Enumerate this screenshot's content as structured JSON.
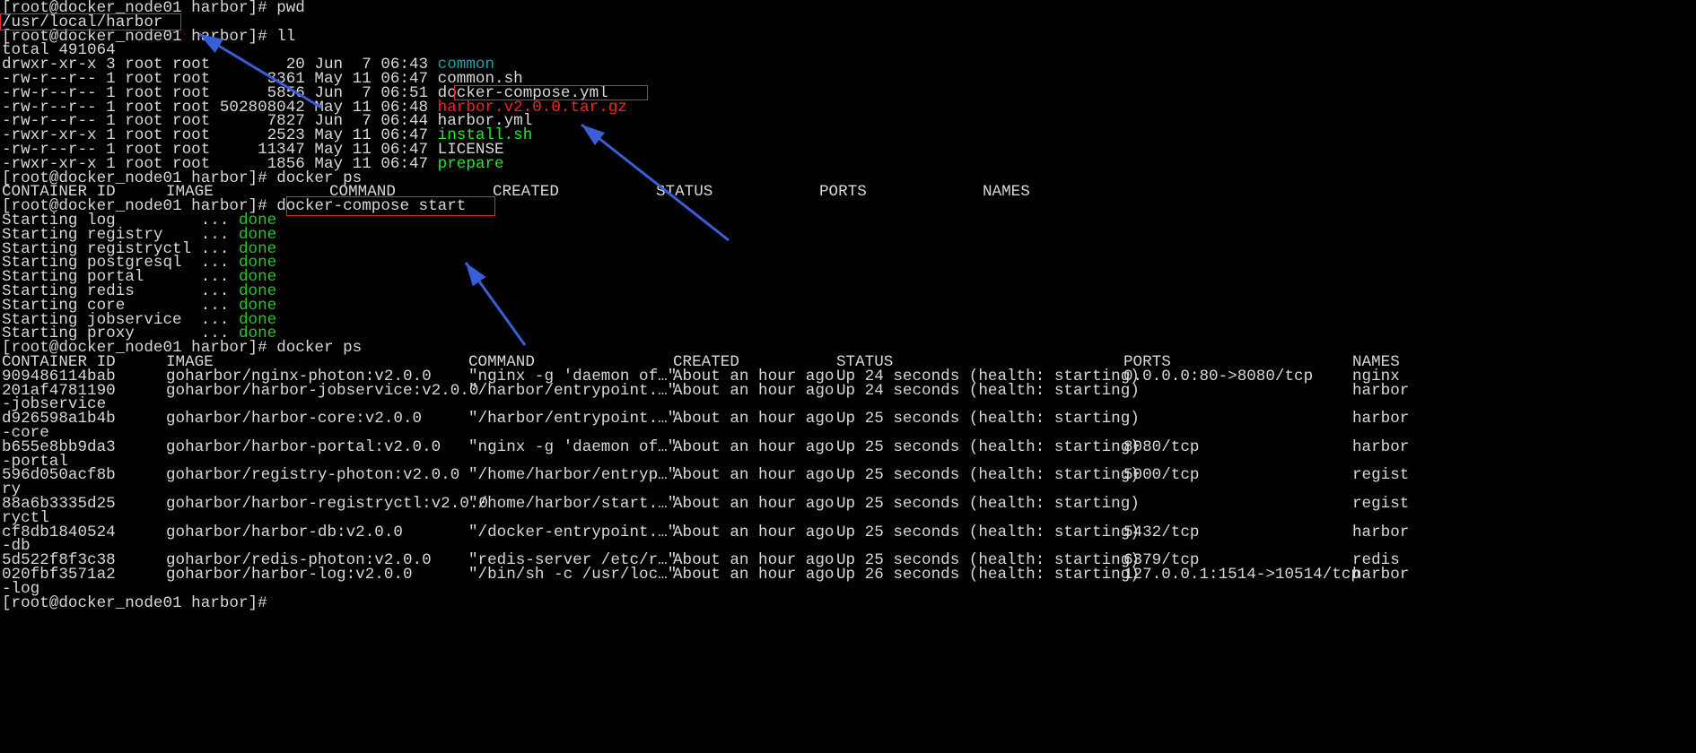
{
  "colors": {
    "background": "#000000",
    "text": "#d8d8d8",
    "dir": "#16a2a6",
    "exec": "#2ee02e",
    "archive": "#ff2020",
    "done": "#2ec22e",
    "highlight": "#e0272a",
    "arrow": "#3a5ed6"
  },
  "prompt": "[root@docker_node01 harbor]# ",
  "cmd_pwd": "pwd",
  "pwd_output": "/usr/local/harbor",
  "cmd_ll": "ll",
  "ll_total": "total 491064",
  "files": [
    {
      "meta": "drwxr-xr-x 3 root root        20 Jun  7 06:43 ",
      "name": "common",
      "kind": "dir"
    },
    {
      "meta": "-rw-r--r-- 1 root root      3361 May 11 06:47 ",
      "name": "common.sh",
      "kind": "file"
    },
    {
      "meta": "-rw-r--r-- 1 root root      5856 Jun  7 06:51 ",
      "name": "docker-compose.yml",
      "kind": "file"
    },
    {
      "meta": "-rw-r--r-- 1 root root 502808042 May 11 06:48 ",
      "name": "harbor.v2.0.0.tar.gz",
      "kind": "archive"
    },
    {
      "meta": "-rw-r--r-- 1 root root      7827 Jun  7 06:44 ",
      "name": "harbor.yml",
      "kind": "file"
    },
    {
      "meta": "-rwxr-xr-x 1 root root      2523 May 11 06:47 ",
      "name": "install.sh",
      "kind": "exec"
    },
    {
      "meta": "-rw-r--r-- 1 root root     11347 May 11 06:47 ",
      "name": "LICENSE",
      "kind": "file"
    },
    {
      "meta": "-rwxr-xr-x 1 root root      1856 May 11 06:47 ",
      "name": "prepare",
      "kind": "exec"
    }
  ],
  "cmd_docker_ps": "docker ps",
  "ps_headers": [
    "CONTAINER ID",
    "IMAGE",
    "COMMAND",
    "CREATED",
    "STATUS",
    "PORTS",
    "NAMES"
  ],
  "cmd_compose_start": "docker-compose start",
  "starting": [
    {
      "label": "Starting log         ... ",
      "status": "done"
    },
    {
      "label": "Starting registry    ... ",
      "status": "done"
    },
    {
      "label": "Starting registryctl ... ",
      "status": "done"
    },
    {
      "label": "Starting postgresql  ... ",
      "status": "done"
    },
    {
      "label": "Starting portal      ... ",
      "status": "done"
    },
    {
      "label": "Starting redis       ... ",
      "status": "done"
    },
    {
      "label": "Starting core        ... ",
      "status": "done"
    },
    {
      "label": "Starting jobservice  ... ",
      "status": "done"
    },
    {
      "label": "Starting proxy       ... ",
      "status": "done"
    }
  ],
  "containers": [
    {
      "id": "909486114bab",
      "image": "goharbor/nginx-photon:v2.0.0",
      "command": "\"nginx -g 'daemon of…\"",
      "created": "About an hour ago",
      "status": "Up 24 seconds (health: starting)",
      "ports": "0.0.0.0:80->8080/tcp",
      "name": "nginx",
      "wrap": ""
    },
    {
      "id": "201af4781190",
      "image": "goharbor/harbor-jobservice:v2.0.0",
      "command": "\"/harbor/entrypoint.…\"",
      "created": "About an hour ago",
      "status": "Up 24 seconds (health: starting)",
      "ports": "",
      "name": "harbor",
      "wrap": "-jobservice"
    },
    {
      "id": "d926598a1b4b",
      "image": "goharbor/harbor-core:v2.0.0",
      "command": "\"/harbor/entrypoint.…\"",
      "created": "About an hour ago",
      "status": "Up 25 seconds (health: starting)",
      "ports": "",
      "name": "harbor",
      "wrap": "-core"
    },
    {
      "id": "b655e8bb9da3",
      "image": "goharbor/harbor-portal:v2.0.0",
      "command": "\"nginx -g 'daemon of…\"",
      "created": "About an hour ago",
      "status": "Up 25 seconds (health: starting)",
      "ports": "8080/tcp",
      "name": "harbor",
      "wrap": "-portal"
    },
    {
      "id": "596d050acf8b",
      "image": "goharbor/registry-photon:v2.0.0",
      "command": "\"/home/harbor/entryp…\"",
      "created": "About an hour ago",
      "status": "Up 25 seconds (health: starting)",
      "ports": "5000/tcp",
      "name": "regist",
      "wrap": "ry"
    },
    {
      "id": "88a6b3335d25",
      "image": "goharbor/harbor-registryctl:v2.0.0",
      "command": "\"/home/harbor/start.…\"",
      "created": "About an hour ago",
      "status": "Up 25 seconds (health: starting)",
      "ports": "",
      "name": "regist",
      "wrap": "ryctl"
    },
    {
      "id": "cf8db1840524",
      "image": "goharbor/harbor-db:v2.0.0",
      "command": "\"/docker-entrypoint.…\"",
      "created": "About an hour ago",
      "status": "Up 25 seconds (health: starting)",
      "ports": "5432/tcp",
      "name": "harbor",
      "wrap": "-db"
    },
    {
      "id": "5d522f8f3c38",
      "image": "goharbor/redis-photon:v2.0.0",
      "command": "\"redis-server /etc/r…\"",
      "created": "About an hour ago",
      "status": "Up 25 seconds (health: starting)",
      "ports": "6379/tcp",
      "name": "redis",
      "wrap": ""
    },
    {
      "id": "020fbf3571a2",
      "image": "goharbor/harbor-log:v2.0.0",
      "command": "\"/bin/sh -c /usr/loc…\"",
      "created": "About an hour ago",
      "status": "Up 26 seconds (health: starting)",
      "ports": "127.0.0.1:1514->10514/tcp",
      "name": "harbor",
      "wrap": "-log"
    }
  ]
}
